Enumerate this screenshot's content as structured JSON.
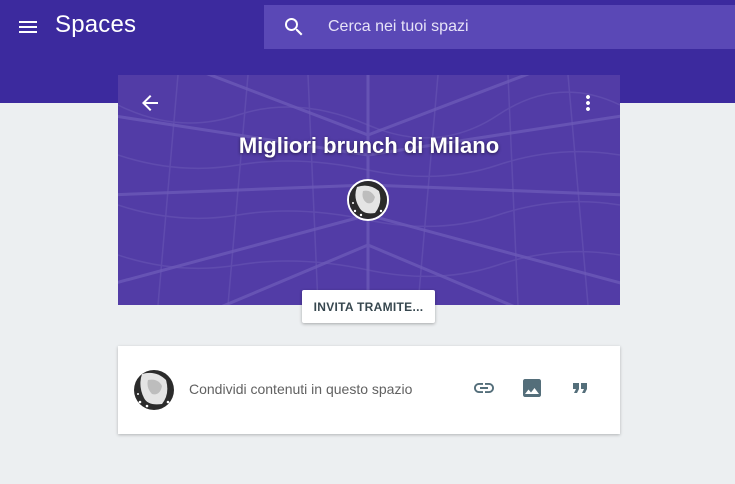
{
  "app": {
    "title": "Spaces"
  },
  "search": {
    "placeholder": "Cerca nei tuoi spazi"
  },
  "space": {
    "title": "Migliori brunch di Milano",
    "invite_label": "INVITA TRAMITE..."
  },
  "composer": {
    "prompt": "Condividi contenuti in questo spazio"
  },
  "colors": {
    "appbar": "#3c2a9e",
    "search_bg": "#5a48b6",
    "hero": "#5840a6",
    "page_bg": "#eceff1",
    "action_icons": "#546e7a"
  },
  "icons": {
    "menu": "menu-icon",
    "search": "search-icon",
    "back": "arrow-back-icon",
    "more": "more-vert-icon",
    "link": "link-icon",
    "image": "image-icon",
    "quote": "format-quote-icon"
  }
}
